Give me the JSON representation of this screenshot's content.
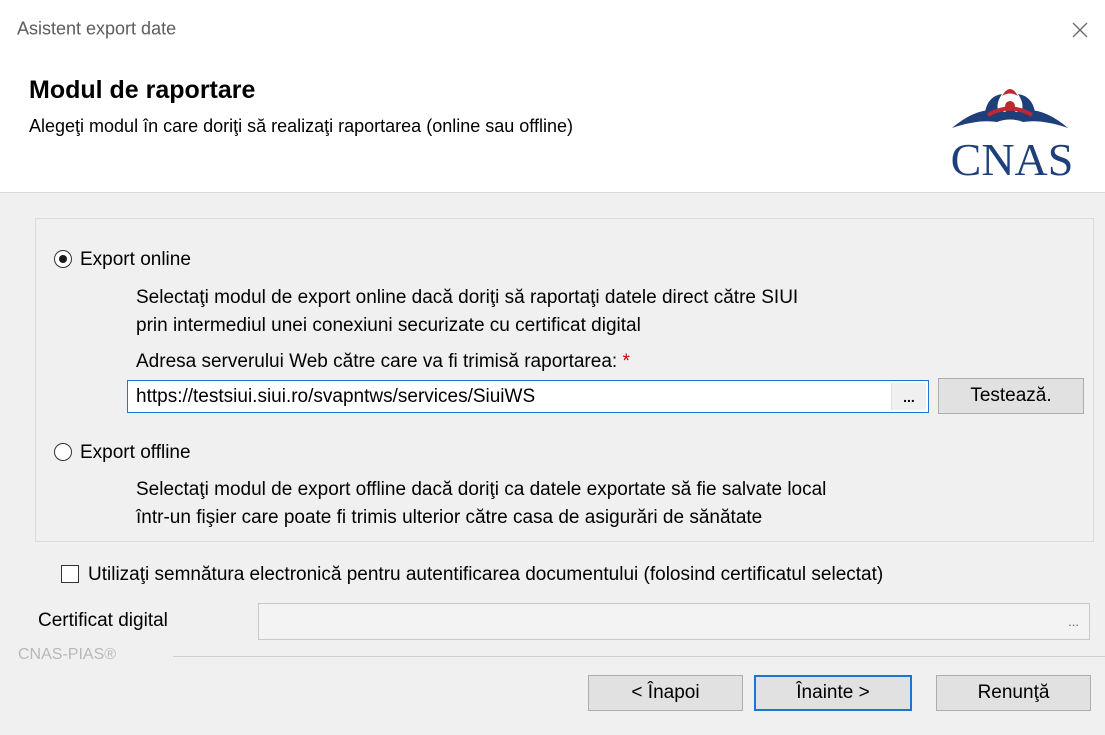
{
  "window": {
    "title": "Asistent export date",
    "close_symbol": "✕"
  },
  "header": {
    "title": "Modul de raportare",
    "subtitle": "Alegeţi modul în care doriţi să realizaţi raportarea (online sau offline)",
    "logo_text": "CNAS",
    "logo_icon": "cnas-eagle-logo"
  },
  "export_online": {
    "label": "Export online",
    "selected": true,
    "description_line1": "Selectaţi modul de export online dacă doriţi să raportaţi datele direct către SIUI",
    "description_line2": "prin intermediul unei conexiuni securizate cu certificat digital",
    "server_label": "Adresa serverului Web către care va fi trimisă raportarea:",
    "required_mark": "*",
    "server_url": "https://testsiui.siui.ro/svapntws/services/SiuiWS",
    "browse_label": "...",
    "test_button": "Testează."
  },
  "export_offline": {
    "label": "Export offline",
    "selected": false,
    "description_line1": "Selectaţi modul de export offline dacă doriţi ca datele exportate să fie salvate local",
    "description_line2": "într-un fişier care poate fi trimis ulterior către casa de asigurări de sănătate"
  },
  "signature": {
    "label": "Utilizaţi semnătura electronică pentru autentificarea documentului (folosind certificatul selectat)",
    "checked": false,
    "cert_label": "Certificat digital",
    "cert_value": "",
    "cert_browse": "..."
  },
  "footer": {
    "group_label": "CNAS-PIAS®",
    "back_button": "< Înapoi",
    "next_button": "Înainte >",
    "cancel_button": "Renunţă"
  },
  "colors": {
    "focus_blue": "#1e74d4",
    "logo_red": "#c0282d",
    "logo_blue": "#1f3f7a",
    "required_red": "#d00000"
  }
}
